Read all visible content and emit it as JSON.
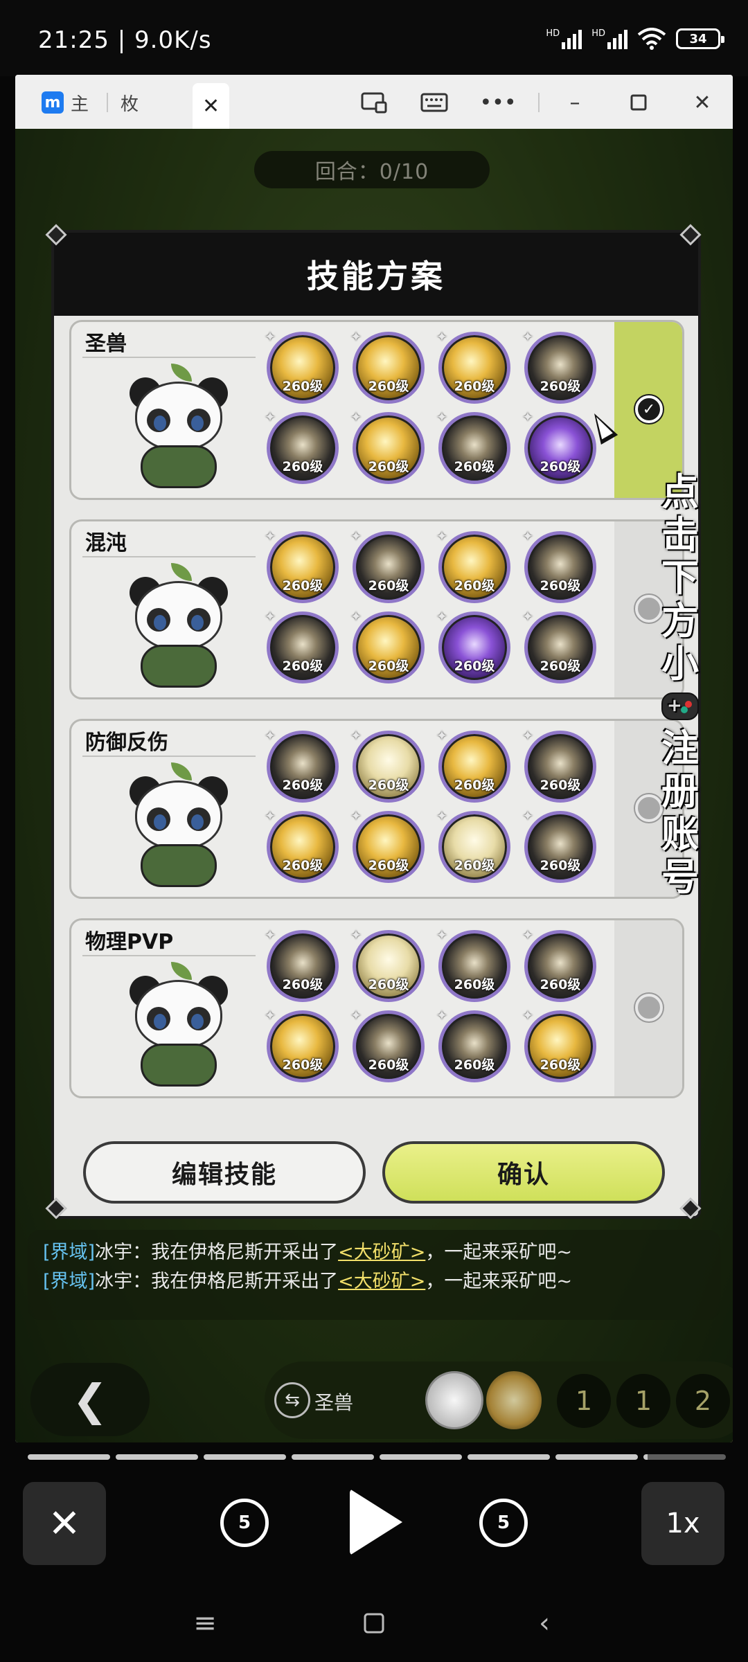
{
  "status": {
    "time": "21:25 | 9.0K/s",
    "hd": "HD",
    "battery": "34"
  },
  "tabs": [
    {
      "label": "主"
    },
    {
      "label": "枚"
    },
    {
      "label": ""
    }
  ],
  "game": {
    "round": "回合：0/10",
    "dialog_title": "技能方案",
    "plans": [
      {
        "name": "圣兽",
        "selected": true,
        "skills": [
          {
            "level": "260级",
            "style": "gold"
          },
          {
            "level": "260级",
            "style": "gold"
          },
          {
            "level": "260级",
            "style": "gold"
          },
          {
            "level": "260级",
            "style": "dark"
          },
          {
            "level": "260级",
            "style": "dark"
          },
          {
            "level": "260级",
            "style": "gold"
          },
          {
            "level": "260级",
            "style": "dark"
          },
          {
            "level": "260级",
            "style": "purple"
          }
        ]
      },
      {
        "name": "混沌",
        "selected": false,
        "skills": [
          {
            "level": "260级",
            "style": "gold"
          },
          {
            "level": "260级",
            "style": "dark"
          },
          {
            "level": "260级",
            "style": "gold"
          },
          {
            "level": "260级",
            "style": "dark"
          },
          {
            "level": "260级",
            "style": "dark"
          },
          {
            "level": "260级",
            "style": "gold"
          },
          {
            "level": "260级",
            "style": "purple"
          },
          {
            "level": "260级",
            "style": "dark"
          }
        ]
      },
      {
        "name": "防御反伤",
        "selected": false,
        "skills": [
          {
            "level": "260级",
            "style": "dark"
          },
          {
            "level": "260级",
            "style": "pale"
          },
          {
            "level": "260级",
            "style": "gold"
          },
          {
            "level": "260级",
            "style": "dark"
          },
          {
            "level": "260级",
            "style": "gold"
          },
          {
            "level": "260级",
            "style": "gold"
          },
          {
            "level": "260级",
            "style": "pale"
          },
          {
            "level": "260级",
            "style": "dark"
          }
        ]
      },
      {
        "name": "物理PVP",
        "selected": false,
        "skills": [
          {
            "level": "260级",
            "style": "dark"
          },
          {
            "level": "260级",
            "style": "pale"
          },
          {
            "level": "260级",
            "style": "dark"
          },
          {
            "level": "260级",
            "style": "dark"
          },
          {
            "level": "260级",
            "style": "gold"
          },
          {
            "level": "260级",
            "style": "dark"
          },
          {
            "level": "260级",
            "style": "dark"
          },
          {
            "level": "260级",
            "style": "gold"
          }
        ]
      }
    ],
    "edit_button": "编辑技能",
    "confirm_button": "确认",
    "chat": [
      {
        "tag": "[界域]",
        "speaker": "冰宇：",
        "text1": "我在伊格尼斯开采出了",
        "ore": "<大砂矿>",
        "text2": "，一起来采矿吧~"
      },
      {
        "tag": "[界域]",
        "speaker": "冰宇：",
        "text1": "我在伊格尼斯开采出了",
        "ore": "<大砂矿>",
        "text2": "，一起来采矿吧~"
      }
    ],
    "bar_label": "圣兽",
    "bar_numbers": [
      "1",
      "1",
      "2"
    ]
  },
  "promo_text": [
    "点",
    "击",
    "下",
    "方",
    "小",
    "注",
    "册",
    "账",
    "号"
  ],
  "player": {
    "rewind": "5",
    "forward": "5",
    "speed": "1x"
  },
  "colors": {
    "selected_plan": "#c3d361",
    "confirm": "#d8e46c",
    "chat_tag": "#66c2f0",
    "chat_ore": "#f3e06a"
  }
}
